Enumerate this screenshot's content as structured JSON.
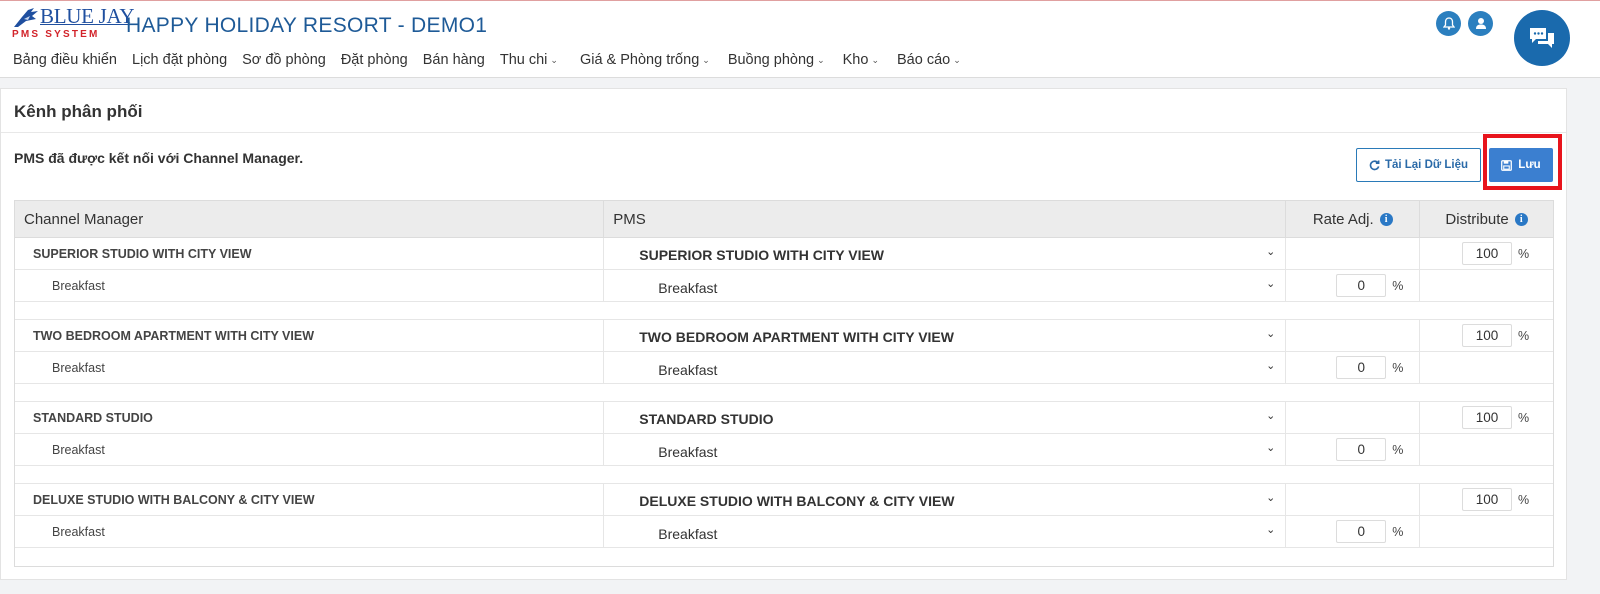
{
  "header": {
    "logo_text": "BLUE JAY",
    "logo_sub": "PMS SYSTEM",
    "title": "HAPPY HOLIDAY RESORT - DEMO1",
    "nav": [
      {
        "label": "Bảng điều khiển",
        "dropdown": false
      },
      {
        "label": "Lịch đặt phòng",
        "dropdown": false
      },
      {
        "label": "Sơ đồ phòng",
        "dropdown": false
      },
      {
        "label": "Đặt phòng",
        "dropdown": false
      },
      {
        "label": "Bán hàng",
        "dropdown": false
      },
      {
        "label": "Thu chi",
        "dropdown": true
      },
      {
        "label": "Giá & Phòng trống",
        "dropdown": true
      },
      {
        "label": "Buồng phòng",
        "dropdown": true
      },
      {
        "label": "Kho",
        "dropdown": true
      },
      {
        "label": "Báo cáo",
        "dropdown": true
      }
    ],
    "icons": [
      "bell-icon",
      "user-icon"
    ],
    "chat_icon": "chat-icon"
  },
  "panel": {
    "title": "Kênh phân phối",
    "status": "PMS đã được kết nối với Channel Manager.",
    "reload_label": "Tải Lại Dữ Liệu",
    "save_label": "Lưu"
  },
  "table": {
    "headers": {
      "channel_manager": "Channel Manager",
      "pms": "PMS",
      "rate_adj": "Rate Adj.",
      "distribute": "Distribute"
    },
    "groups": [
      {
        "room": "SUPERIOR STUDIO WITH CITY VIEW",
        "pms_room": "SUPERIOR STUDIO WITH CITY VIEW",
        "distribute": "100",
        "rate": "Breakfast",
        "pms_rate": "Breakfast",
        "rate_adj": "0"
      },
      {
        "room": "TWO BEDROOM APARTMENT WITH CITY VIEW",
        "pms_room": "TWO BEDROOM APARTMENT WITH CITY VIEW",
        "distribute": "100",
        "rate": "Breakfast",
        "pms_rate": "Breakfast",
        "rate_adj": "0"
      },
      {
        "room": "STANDARD STUDIO",
        "pms_room": "STANDARD STUDIO",
        "distribute": "100",
        "rate": "Breakfast",
        "pms_rate": "Breakfast",
        "rate_adj": "0"
      },
      {
        "room": "DELUXE STUDIO WITH BALCONY & CITY VIEW",
        "pms_room": "DELUXE STUDIO WITH BALCONY & CITY VIEW",
        "distribute": "100",
        "rate": "Breakfast",
        "pms_rate": "Breakfast",
        "rate_adj": "0"
      }
    ],
    "percent_sign": "%"
  },
  "colors": {
    "brand_blue": "#1e5a97",
    "button_blue": "#3b7fd0",
    "highlight_red": "#e8141c"
  }
}
